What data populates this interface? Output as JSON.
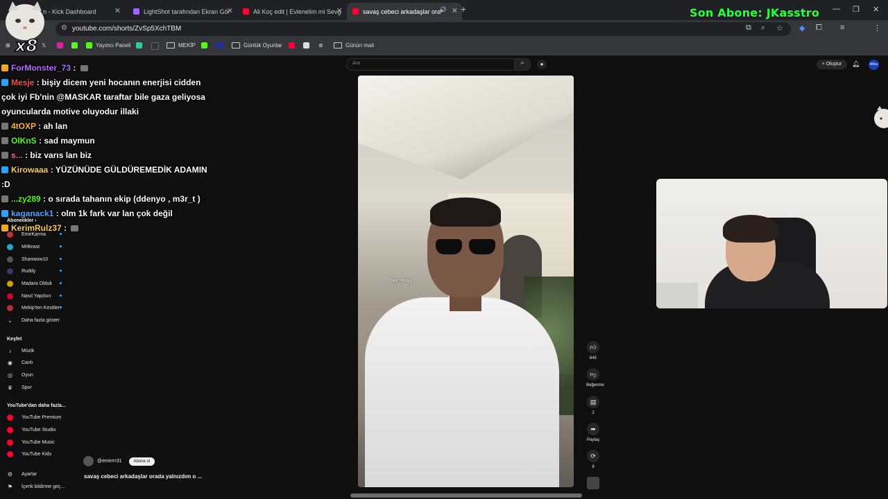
{
  "browser": {
    "tabs": [
      {
        "title": "n - Kick Dashboard",
        "favicon_color": "#53fc18"
      },
      {
        "title": "LightShot tarafından Ekran Gör",
        "favicon_color": "#a066ff"
      },
      {
        "title": "Ali Koç edit | Evlenelim mi Sevg",
        "favicon_color": "#ff0033"
      },
      {
        "title": "savaş cebeci arkadaşlar ora",
        "favicon_color": "#ff0033"
      }
    ],
    "url": "youtube.com/shorts/ZvSp5XchTBM",
    "bookmarks": [
      {
        "label": "Yayıncı Paneli"
      },
      {
        "label": "MEKİP"
      },
      {
        "label": "Günlük Oyunlar"
      },
      {
        "label": "Günün malı"
      }
    ]
  },
  "overlay": {
    "sub_alert": "Son Abone: JKasstro",
    "logo_text": "x8",
    "chat": [
      {
        "user": "ForMonster_73",
        "user_color": "#b66dff",
        "badge_color": "#f5a623",
        "text": "",
        "emote": true
      },
      {
        "user": "Mesje",
        "user_color": "#ff4d4d",
        "badge_color": "#2aa0ff",
        "text": "bişiy dicem yeni hocanın enerjisi cidden çok iyi Fb'nin @MASKAR taraftar bile gaza geliyosa oyuncularda motive oluyodur illaki",
        "emote": false
      },
      {
        "user": "4tOXP",
        "user_color": "#ffb347",
        "badge_color": "#777777",
        "text": "ah lan",
        "emote": false
      },
      {
        "user": "OlKnS",
        "user_color": "#53fc18",
        "badge_color": "#777777",
        "text": "sad maymun",
        "emote": false
      },
      {
        "user": "s...",
        "user_color": "#ff6b9a",
        "badge_color": "#777777",
        "text": "biz varıs lan biz",
        "emote": false
      },
      {
        "user": "Kirowaaa",
        "user_color": "#ffcf4d",
        "badge_color": "#2aa0ff",
        "text": "YÜZÜNÜDE GÜLDÜREMEDİK ADAMIN :D",
        "emote": false
      },
      {
        "user": "...zy289",
        "user_color": "#53fc18",
        "badge_color": "#777777",
        "text": "o sırada tahanın ekip (ddenyo , m3r_t )",
        "emote": false
      },
      {
        "user": "kaganack1",
        "user_color": "#4da6ff",
        "badge_color": "#2aa0ff",
        "text": "olm 1k fark var lan çok değil",
        "emote": false
      },
      {
        "user": "KerimRulz37",
        "user_color": "#ffcf4d",
        "badge_color": "#f5a623",
        "text": "",
        "emote": true
      }
    ]
  },
  "youtube": {
    "search_placeholder": "Ara",
    "create_label": "Oluştur",
    "avatar_label": "Aflou",
    "sidebar": {
      "subs_heading": "Abonelikler",
      "subscriptions": [
        {
          "name": "EmirKarma",
          "color": "#b33"
        },
        {
          "name": "MrBeast",
          "color": "#2aa4c7"
        },
        {
          "name": "Shanwow10",
          "color": "#555"
        },
        {
          "name": "Ruddy",
          "color": "#3a3a6a"
        },
        {
          "name": "Madara Olduk",
          "color": "#c9a400"
        },
        {
          "name": "Nasıl Yapılsın",
          "color": "#c03"
        },
        {
          "name": "Mekip'ten Kesitler",
          "color": "#a33"
        }
      ],
      "show_more": "Daha fazla göster",
      "explore_heading": "Keşfet",
      "explore": [
        {
          "name": "Müzik",
          "icon": "music-icon"
        },
        {
          "name": "Canlı",
          "icon": "live-icon"
        },
        {
          "name": "Oyun",
          "icon": "gamepad-icon"
        },
        {
          "name": "Spor",
          "icon": "trophy-icon"
        }
      ],
      "more_heading": "YouTube'dan daha fazla...",
      "more": [
        {
          "name": "YouTube Premium"
        },
        {
          "name": "YouTube Studio"
        },
        {
          "name": "YouTube Music"
        },
        {
          "name": "YouTube Kids"
        }
      ],
      "settings": "Ayarlar",
      "report": "İçerik bildirme geç..."
    },
    "short": {
      "video_label": "ben_froxy",
      "likes": "645",
      "dislike_label": "Beğenme",
      "comments": "2",
      "share_label": "Paylaş",
      "remix_count": "8",
      "channel": "@emirrrr31",
      "subscribe_label": "Abone ol",
      "title": "savaş cebeci arkadaşlar orada yalnızdım o ..."
    }
  }
}
